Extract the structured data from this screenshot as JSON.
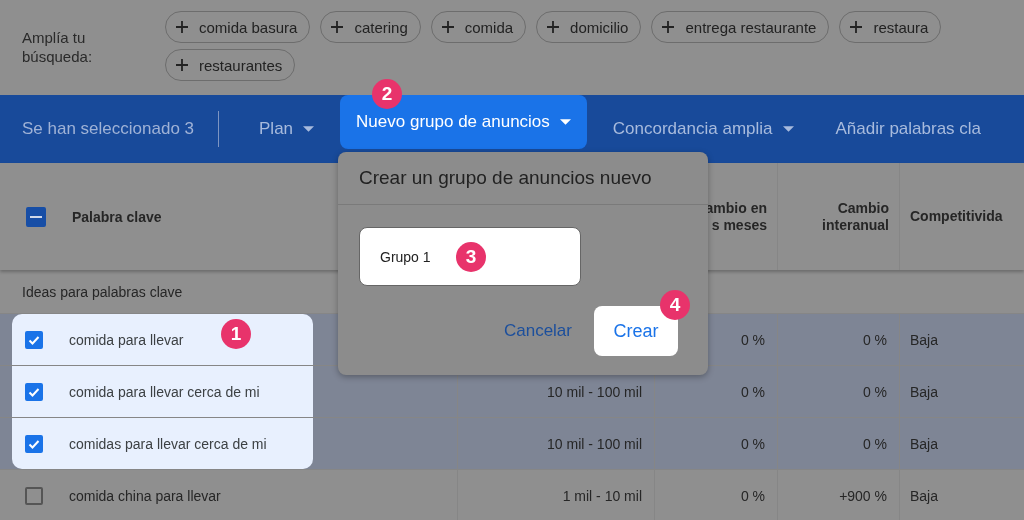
{
  "expand_search": {
    "label": "Amplía tu búsqueda:",
    "chips": [
      {
        "label": "comida basura"
      },
      {
        "label": "catering"
      },
      {
        "label": "comida"
      },
      {
        "label": "domicilio"
      },
      {
        "label": "entrega restaurante"
      },
      {
        "label": "restaura"
      },
      {
        "label": "restaurantes"
      }
    ]
  },
  "toolbar": {
    "selection": "Se han seleccionado 3",
    "menus": [
      {
        "label": "Plan",
        "highlighted": false
      },
      {
        "label": "Nuevo grupo de anuncios",
        "highlighted": true,
        "step": "2"
      },
      {
        "label": "Concordancia amplia",
        "highlighted": false
      },
      {
        "label": "Añadir palabras cla",
        "highlighted": false
      }
    ]
  },
  "table": {
    "select_all_partial": true,
    "columns": [
      {
        "label": "Palabra clave"
      },
      {},
      {
        "label": "ambio en\ns meses"
      },
      {
        "label": "Cambio interanual"
      },
      {
        "label": "Competitivida"
      }
    ],
    "section": "Ideas para palabras clave",
    "rows": [
      {
        "checked": true,
        "highlighted": true,
        "step": "1",
        "cells": [
          "comida para llevar",
          "",
          "0 %",
          "0 %",
          "Baja"
        ]
      },
      {
        "checked": true,
        "highlighted": true,
        "cells": [
          "comida para llevar cerca de mi",
          "10 mil - 100 mil",
          "0 %",
          "0 %",
          "Baja"
        ]
      },
      {
        "checked": true,
        "highlighted": true,
        "cells": [
          "comidas para llevar cerca de mi",
          "10 mil - 100 mil",
          "0 %",
          "0 %",
          "Baja"
        ]
      },
      {
        "checked": false,
        "highlighted": false,
        "cells": [
          "comida china para llevar",
          "1 mil - 10 mil",
          "0 %",
          "+900 %",
          "Baja"
        ]
      }
    ]
  },
  "dialog": {
    "title": "Crear un grupo de anuncios nuevo",
    "input": {
      "value": "Grupo 1",
      "step": "3"
    },
    "cancel": "Cancelar",
    "create": {
      "label": "Crear",
      "step": "4"
    }
  }
}
